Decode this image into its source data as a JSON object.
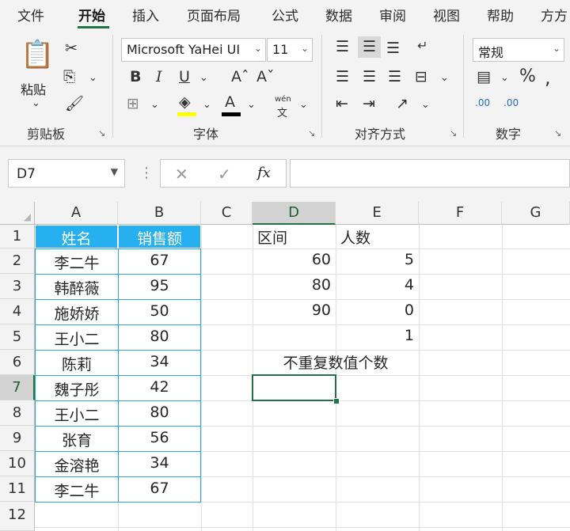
{
  "tabs": [
    "文件",
    "开始",
    "插入",
    "页面布局",
    "公式",
    "数据",
    "审阅",
    "视图",
    "帮助",
    "方方"
  ],
  "ribbon": {
    "paste_label": "粘贴",
    "clipboard_group": "剪贴板",
    "font_name": "Microsoft YaHei UI",
    "font_size": "11",
    "font_group": "字体",
    "bold": "B",
    "italic": "I",
    "underline": "U",
    "font_color_glyph": "A",
    "phonetic_top": "wén",
    "phonetic_bottom": "文",
    "align_group": "对齐方式",
    "number_format": "常规",
    "number_group": "数字",
    "dec_inc": ".00",
    "dec_dec": ".00"
  },
  "formula_bar": {
    "name_box": "D7",
    "fx_label": "fx",
    "formula": ""
  },
  "columns": [
    "A",
    "B",
    "C",
    "D",
    "E",
    "F",
    "G"
  ],
  "rows": [
    "1",
    "2",
    "3",
    "4",
    "5",
    "6",
    "7",
    "8",
    "9",
    "10",
    "11",
    "12"
  ],
  "table": {
    "header_name": "姓名",
    "header_sales": "销售额",
    "names": [
      "李二牛",
      "韩醉薇",
      "施娇娇",
      "王小二",
      "陈莉",
      "魏子彤",
      "王小二",
      "张育",
      "金溶艳",
      "李二牛"
    ],
    "sales": [
      "67",
      "95",
      "50",
      "80",
      "34",
      "42",
      "80",
      "56",
      "34",
      "67"
    ]
  },
  "freq": {
    "header_interval": "区间",
    "header_count": "人数",
    "intervals": [
      "60",
      "80",
      "90"
    ],
    "counts": [
      "5",
      "4",
      "0",
      "1"
    ]
  },
  "distinct_label": "不重复数值个数",
  "active_cell": "D7",
  "colors": {
    "accent": "#217346",
    "table_header": "#27b0f0"
  }
}
